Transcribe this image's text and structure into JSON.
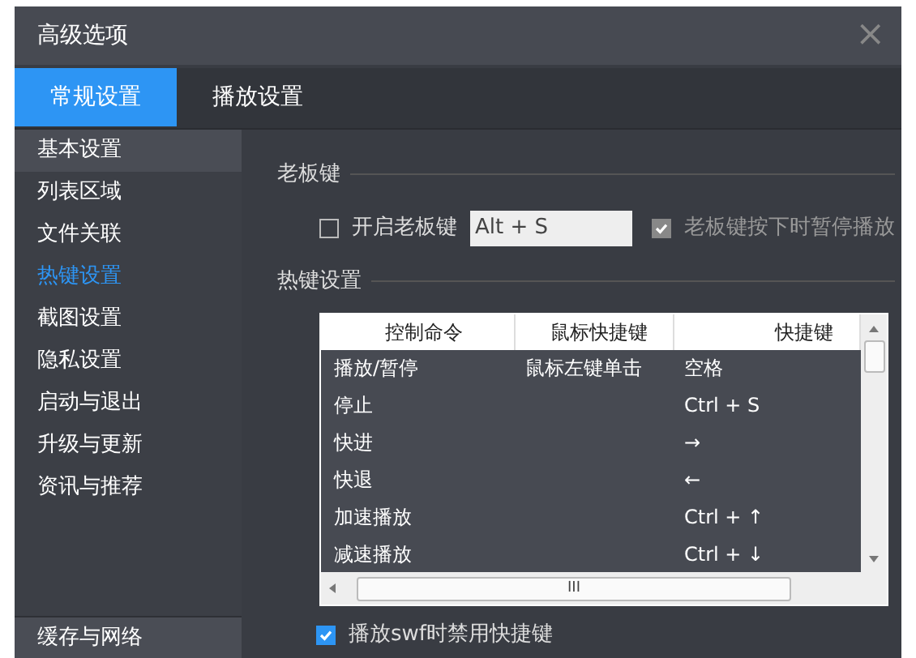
{
  "window": {
    "title": "高级选项",
    "close": "×"
  },
  "tabs": [
    {
      "label": "常规设置",
      "selected": true
    },
    {
      "label": "播放设置",
      "selected": false
    }
  ],
  "sidebar": {
    "items": [
      {
        "label": "基本设置",
        "selected": false,
        "hovered": true
      },
      {
        "label": "列表区域",
        "selected": false,
        "hovered": false
      },
      {
        "label": "文件关联",
        "selected": false,
        "hovered": false
      },
      {
        "label": "热键设置",
        "selected": true,
        "hovered": false
      },
      {
        "label": "截图设置",
        "selected": false,
        "hovered": false
      },
      {
        "label": "隐私设置",
        "selected": false,
        "hovered": false
      },
      {
        "label": "启动与退出",
        "selected": false,
        "hovered": false
      },
      {
        "label": "升级与更新",
        "selected": false,
        "hovered": false
      },
      {
        "label": "资讯与推荐",
        "selected": false,
        "hovered": false
      }
    ],
    "footer_item": {
      "label": "缓存与网络",
      "hovered": true
    }
  },
  "boss_key": {
    "heading": "老板键",
    "enable": {
      "label": "开启老板键",
      "checked": false,
      "disabled": false
    },
    "key_value": "Alt + S",
    "pause": {
      "label": "老板键按下时暂停播放",
      "checked": true,
      "disabled": true
    }
  },
  "hotkeys": {
    "heading": "热键设置",
    "table": {
      "columns": [
        "控制命令",
        "鼠标快捷键",
        "快捷键"
      ],
      "rows": [
        [
          "播放/暂停",
          "鼠标左键单击",
          "空格"
        ],
        [
          "停止",
          "",
          "Ctrl + S"
        ],
        [
          "快进",
          "",
          "→"
        ],
        [
          "快退",
          "",
          "←"
        ],
        [
          "加速播放",
          "",
          "Ctrl + ↑"
        ],
        [
          "减速播放",
          "",
          "Ctrl + ↓"
        ]
      ],
      "scroll_grip": "III"
    },
    "disable_swf": {
      "label": "播放swf时禁用快捷键",
      "checked": true,
      "disabled": false
    }
  }
}
